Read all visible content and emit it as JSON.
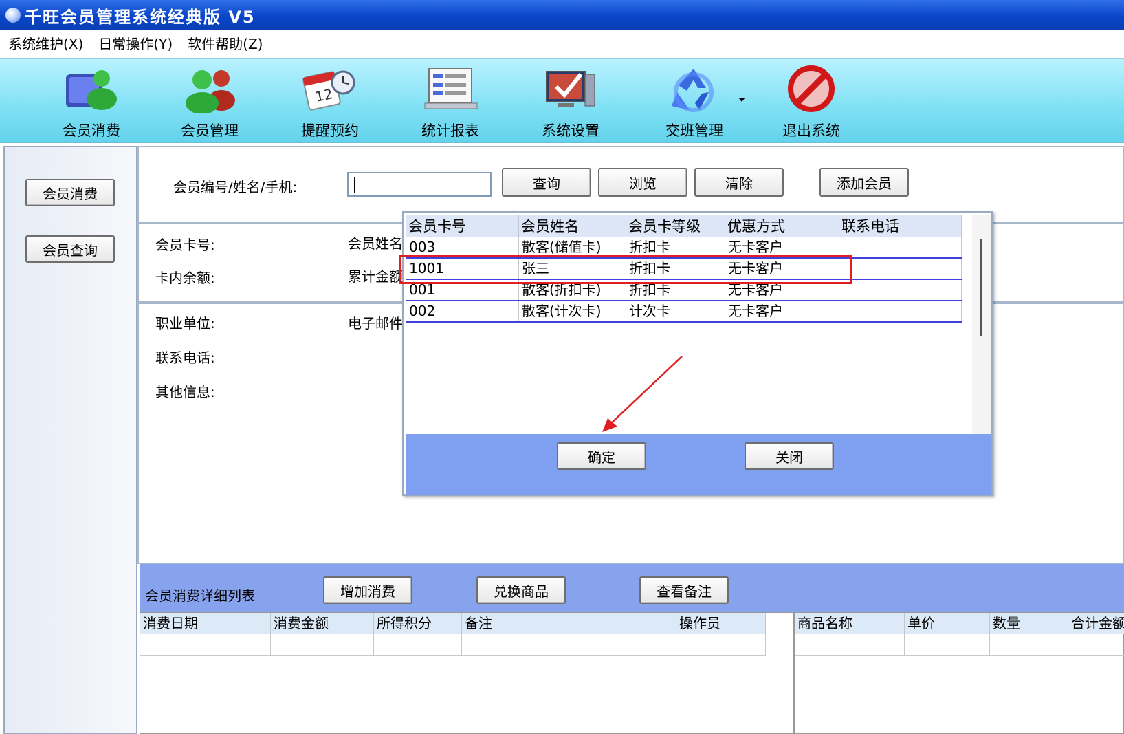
{
  "window": {
    "title": "千旺会员管理系统经典版 V5"
  },
  "menu": [
    {
      "label": "系统维护(X)"
    },
    {
      "label": "日常操作(Y)"
    },
    {
      "label": "软件帮助(Z)"
    }
  ],
  "toolbar": [
    {
      "label": "会员消费",
      "icon": "member-consume-icon"
    },
    {
      "label": "会员管理",
      "icon": "member-manage-icon"
    },
    {
      "label": "提醒预约",
      "icon": "calendar-clock-icon"
    },
    {
      "label": "统计报表",
      "icon": "report-icon"
    },
    {
      "label": "系统设置",
      "icon": "settings-monitor-icon"
    },
    {
      "label": "交班管理",
      "icon": "recycle-icon"
    },
    {
      "label": "退出系统",
      "icon": "exit-icon"
    }
  ],
  "sidebar": {
    "consume_label": "会员消费",
    "query_label": "会员查询"
  },
  "search": {
    "label": "会员编号/姓名/手机:",
    "value": "",
    "query_label": "查询",
    "browse_label": "浏览",
    "clear_label": "清除",
    "add_label": "添加会员"
  },
  "info": {
    "card_no": "会员卡号:",
    "name": "会员姓名",
    "balance": "卡内余额:",
    "total": "累计金额",
    "work": "职业单位:",
    "email": "电子邮件",
    "phone": "联系电话:",
    "other": "其他信息:"
  },
  "details": {
    "title": "会员消费详细列表",
    "add_label": "增加消费",
    "exchange_label": "兑换商品",
    "note_label": "查看备注",
    "left_columns": [
      "消费日期",
      "消费金额",
      "所得积分",
      "备注",
      "操作员"
    ],
    "right_columns": [
      "商品名称",
      "单价",
      "数量",
      "合计金额"
    ]
  },
  "popup": {
    "columns": [
      "会员卡号",
      "会员姓名",
      "会员卡等级",
      "优惠方式",
      "联系电话"
    ],
    "rows": [
      [
        "003",
        "散客(储值卡)",
        "折扣卡",
        "无卡客户",
        ""
      ],
      [
        "1001",
        "张三",
        "折扣卡",
        "无卡客户",
        ""
      ],
      [
        "001",
        "散客(折扣卡)",
        "折扣卡",
        "无卡客户",
        ""
      ],
      [
        "002",
        "散客(计次卡)",
        "计次卡",
        "无卡客户",
        ""
      ]
    ],
    "ok_label": "确定",
    "close_label": "关闭"
  },
  "colors": {
    "titlebar": "#0a45c8",
    "toolbar": "#7fe0f4",
    "popup_footer": "#7f9ff0",
    "highlight": "#e02020"
  }
}
